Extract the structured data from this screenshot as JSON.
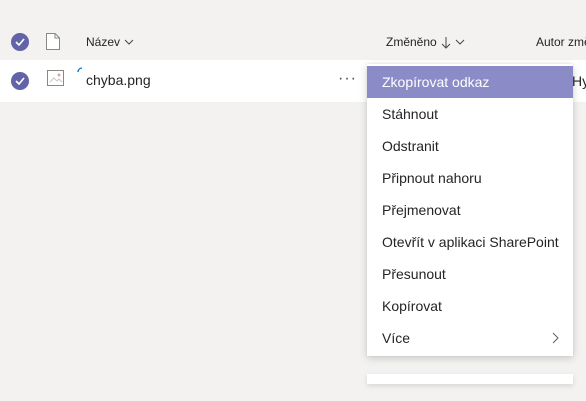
{
  "colors": {
    "accent": "#6264a7",
    "menu_highlight": "#8b8cc7",
    "background": "#f3f2f1"
  },
  "header": {
    "name_label": "Název",
    "modified_label": "Změněno",
    "modified_sort_icon": "arrow-down-icon",
    "author_label": "Autor změ"
  },
  "file": {
    "name": "chyba.png",
    "more_label": "···",
    "author_cutoff": "Hy"
  },
  "context_menu": {
    "items": [
      {
        "label": "Zkopírovat odkaz"
      },
      {
        "label": "Stáhnout"
      },
      {
        "label": "Odstranit"
      },
      {
        "label": "Připnout nahoru"
      },
      {
        "label": "Přejmenovat"
      },
      {
        "label": "Otevřít v aplikaci SharePoint"
      },
      {
        "label": "Přesunout"
      },
      {
        "label": "Kopírovat"
      },
      {
        "label": "Více"
      }
    ]
  }
}
